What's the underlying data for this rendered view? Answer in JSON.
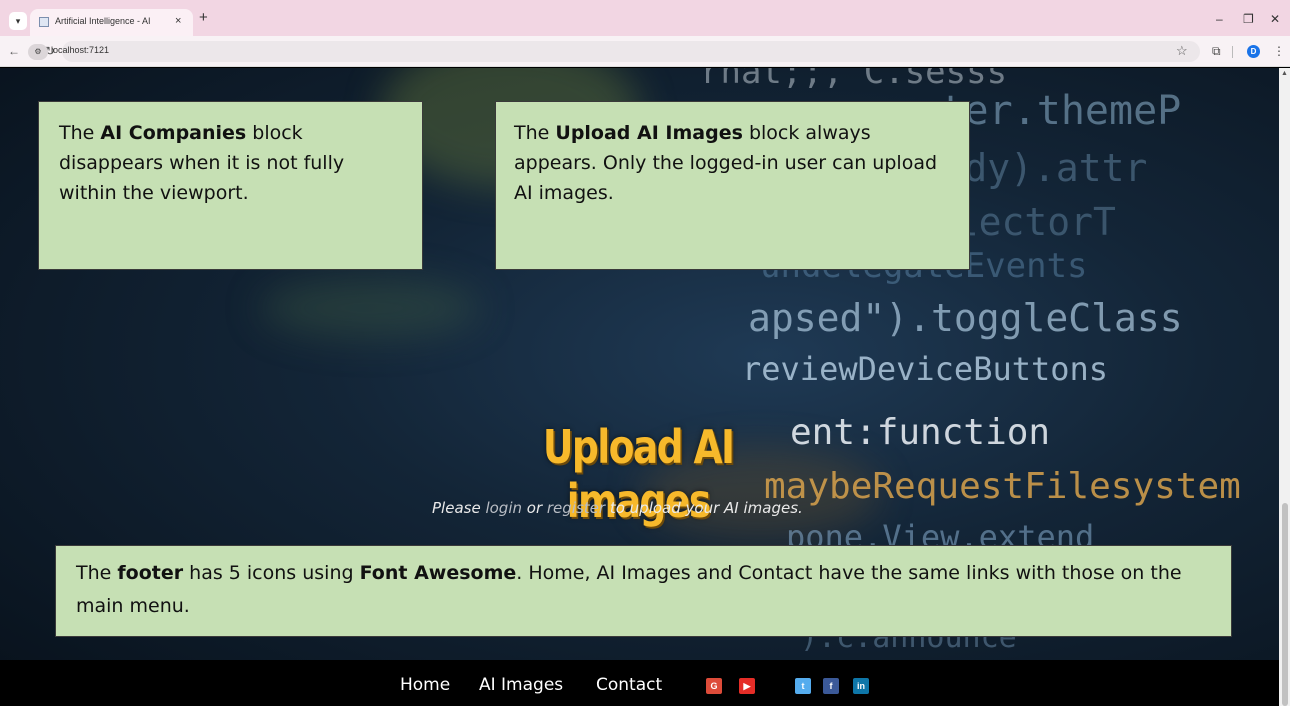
{
  "browser": {
    "tab_title": "Artificial Intelligence - AI",
    "tab_close": "×",
    "new_tab": "+",
    "url": "localhost:7121",
    "profile_initial": "D",
    "icons": {
      "tab_menu": "chevron-down-icon",
      "back": "back-arrow-icon",
      "forward": "forward-arrow-icon",
      "reload": "reload-icon",
      "site_info": "site-info-icon",
      "bookmark": "star-icon",
      "extensions": "puzzle-icon",
      "menu": "kebab-menu-icon"
    },
    "window_controls": {
      "minimize": "–",
      "restore": "❐",
      "close": "✕"
    }
  },
  "notes": {
    "companies": {
      "pre": "The ",
      "bold": "AI Companies",
      "post": " block disappears when it is not fully within the viewport."
    },
    "upload": {
      "pre": "The ",
      "bold": "Upload AI Images",
      "post": " block always appears. Only the logged-in user can upload AI images."
    },
    "footer": {
      "pre": "The ",
      "bold1": "footer",
      "mid": " has 5 icons using ",
      "bold2": "Font Awesome",
      "post": ". Home, AI Images and Contact have the same links with those on the main menu."
    }
  },
  "hero": {
    "title": "Upload AI images",
    "sub_please": "Please ",
    "login": "login",
    "or": " or ",
    "register": "register",
    "sub_rest": " to upload your AI images."
  },
  "background_code": {
    "line0": "rhat;;, C.sesss",
    "line1": "c.router.themeP",
    "line2": "nt.body).attr",
    "line3": "selectorT",
    "line4": "undelegateEvents",
    "line5": "apsed\").toggleClass",
    "line6": "reviewDeviceButtons",
    "line7": "ent:function",
    "line8": "maybeRequestFilesystem",
    "line9": "pone.View.extend",
    "line10": ").c.announce"
  },
  "footer": {
    "links": [
      "Home",
      "AI Images",
      "Contact"
    ],
    "social": [
      {
        "icon": "google-plus-icon",
        "glyph": "G",
        "color": "#dd4b39"
      },
      {
        "icon": "youtube-icon",
        "glyph": "▶",
        "color": "#e52d27"
      },
      {
        "icon": "twitter-icon",
        "glyph": "t",
        "color": "#55acee"
      },
      {
        "icon": "facebook-icon",
        "glyph": "f",
        "color": "#3b5998"
      },
      {
        "icon": "linkedin-icon",
        "glyph": "in",
        "color": "#0e76a8"
      }
    ]
  }
}
